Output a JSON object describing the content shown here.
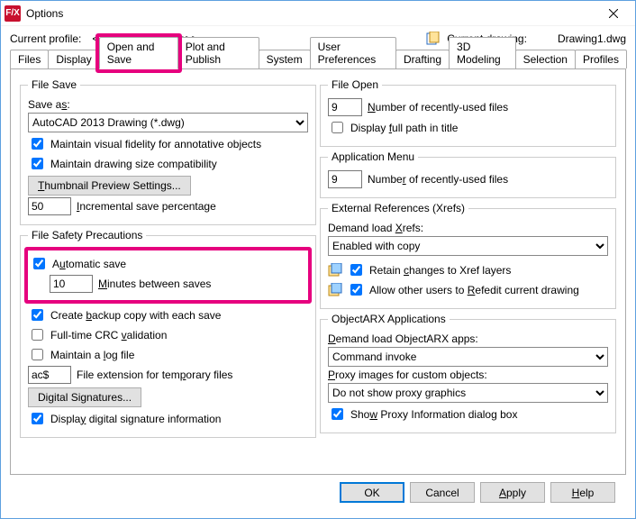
{
  "window": {
    "title": "Options"
  },
  "profile": {
    "label": "Current profile:",
    "value": "<<Unnamed Profile>>",
    "drawing_label": "Current drawing:",
    "drawing_value": "Drawing1.dwg"
  },
  "tabs": {
    "files": "Files",
    "display": "Display",
    "open_save": "Open and Save",
    "plot": "Plot and Publish",
    "system": "System",
    "user_prefs": "User Preferences",
    "drafting": "Drafting",
    "modeling": "3D Modeling",
    "selection": "Selection",
    "profiles": "Profiles",
    "active": "open_save"
  },
  "file_save": {
    "legend": "File Save",
    "save_as_label": "Save as:",
    "save_as_value": "AutoCAD 2013 Drawing (*.dwg)",
    "annotative": "Maintain visual fidelity for annotative objects",
    "annotative_checked": true,
    "compat": "Maintain drawing size compatibility",
    "compat_checked": true,
    "thumb_btn": "Thumbnail Preview Settings...",
    "isp_value": "50",
    "isp_label": "Incremental save percentage"
  },
  "safety": {
    "legend": "File Safety Precautions",
    "auto_save": "Automatic save",
    "auto_save_checked": true,
    "minutes_value": "10",
    "minutes_label": "Minutes between saves",
    "backup": "Create backup copy with each save",
    "backup_checked": true,
    "crc": "Full-time CRC validation",
    "crc_checked": false,
    "log": "Maintain a log file",
    "log_checked": false,
    "ext_value": "ac$",
    "ext_label": "File extension for temporary files",
    "sig_btn": "Digital Signatures...",
    "disp_sig": "Display digital signature information",
    "disp_sig_checked": true
  },
  "file_open": {
    "legend": "File Open",
    "recent_value": "9",
    "recent_label": "Number of recently-used files",
    "fullpath": "Display full path in title",
    "fullpath_checked": false
  },
  "app_menu": {
    "legend": "Application Menu",
    "recent_value": "9",
    "recent_label": "Number of recently-used files"
  },
  "xrefs": {
    "legend": "External References (Xrefs)",
    "demand_label": "Demand load Xrefs:",
    "demand_value": "Enabled with copy",
    "retain": "Retain changes to Xref layers",
    "retain_checked": true,
    "allow": "Allow other users to Refedit current drawing",
    "allow_checked": true
  },
  "arx": {
    "legend": "ObjectARX Applications",
    "demand_label": "Demand load ObjectARX apps:",
    "demand_value": "Command invoke",
    "proxy_label": "Proxy images for custom objects:",
    "proxy_value": "Do not show proxy graphics",
    "show_dlg": "Show Proxy Information dialog box",
    "show_dlg_checked": true
  },
  "buttons": {
    "ok": "OK",
    "cancel": "Cancel",
    "apply": "Apply",
    "help": "Help"
  }
}
